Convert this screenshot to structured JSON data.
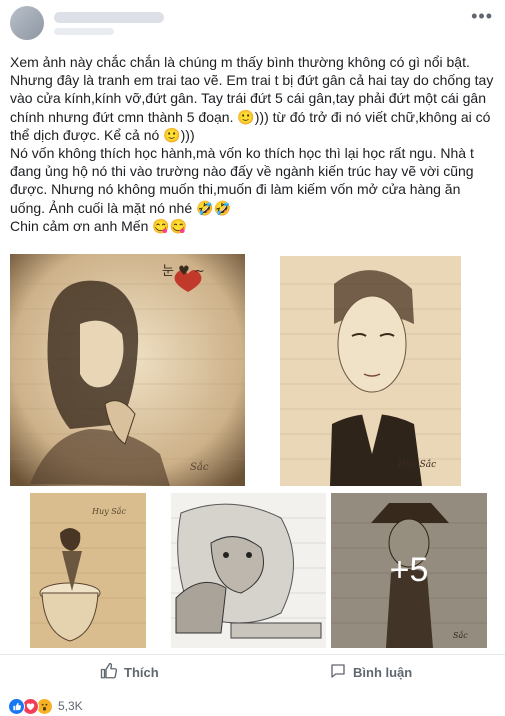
{
  "post": {
    "author_name": "",
    "more_icon": "ellipsis-icon",
    "paragraphs": [
      "Xem ảnh này chắc chắn là chúng m thấy bình thường không có gì nổi bật.",
      "Nhưng đây là tranh em trai tao vẽ. Em trai t bị đứt gân cả hai tay do chống tay vào cửa kính,kính vỡ,đứt gân. Tay trái đứt 5 cái gân,tay phải đứt một cái gân chính nhưng đứt cmn thành 5 đoạn. 🙂))) từ đó trở đi nó viết chữ,không ai có thể dịch được. Kể cả nó 🙂)))",
      "Nó vốn không thích học hành,mà vốn ko thích học thì lại học rất ngu. Nhà t đang ủng hộ nó thi vào trường nào đấy về ngành kiến trúc hay vẽ vời cũng được. Nhưng nó không muốn thi,muốn đi làm kiếm vốn mở cửa hàng ăn uống. Ảnh cuối là mặt nó nhé 🤣🤣",
      "Chin cảm ơn anh Mến 😋😋"
    ]
  },
  "photos": {
    "items": [
      {
        "subject": "girl-with-heart sketch",
        "caption": "눈 ♥ ~",
        "signature": "Sắc"
      },
      {
        "subject": "portrait sketch",
        "signature": "Huy Sắc"
      },
      {
        "subject": "boy-on-toilet sketch",
        "signature": "Huy Sắc"
      },
      {
        "subject": "lion sketch"
      },
      {
        "subject": "girl in ao dai sketch",
        "signature": "Sắc"
      }
    ],
    "more_count_label": "+5"
  },
  "actions": {
    "like_label": "Thích",
    "like_icon": "thumbs-up-icon",
    "comment_label": "Bình luận",
    "comment_icon": "comment-icon"
  },
  "reactions": {
    "icons": [
      "like-reaction-icon",
      "love-reaction-icon",
      "wow-reaction-icon"
    ],
    "count": "5,3K"
  },
  "colors": {
    "link_blue": "#1877f2",
    "muted_text": "#606770",
    "paper": "#e7d2b0"
  }
}
